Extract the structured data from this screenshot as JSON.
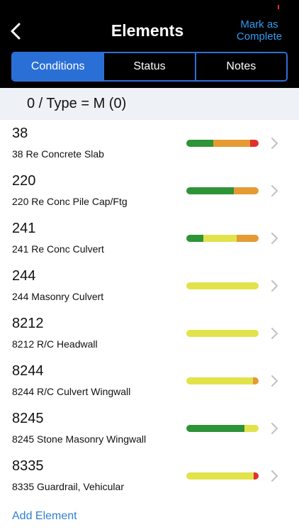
{
  "header": {
    "title": "Elements",
    "mark_complete": "Mark as Complete",
    "back_icon": "chevron-left-icon"
  },
  "tabs": [
    {
      "label": "Conditions",
      "active": true
    },
    {
      "label": "Status",
      "active": false
    },
    {
      "label": "Notes",
      "active": false
    }
  ],
  "filter": {
    "text": "0 / Type = M (0)"
  },
  "colors": {
    "green": "#2e9437",
    "yellow": "#e2e34a",
    "orange": "#e59a33",
    "red": "#e0312b",
    "accent": "#2a6fd6",
    "link": "#2f7fd1"
  },
  "elements": [
    {
      "code": "38",
      "description": "38 Re Concrete Slab",
      "condition": [
        {
          "state": "green",
          "fraction": 0.37
        },
        {
          "state": "orange",
          "fraction": 0.51
        },
        {
          "state": "red",
          "fraction": 0.12
        }
      ]
    },
    {
      "code": "220",
      "description": "220 Re Conc Pile Cap/Ftg",
      "condition": [
        {
          "state": "green",
          "fraction": 0.66
        },
        {
          "state": "orange",
          "fraction": 0.34
        }
      ]
    },
    {
      "code": "241",
      "description": "241 Re Conc Culvert",
      "condition": [
        {
          "state": "green",
          "fraction": 0.24
        },
        {
          "state": "yellow",
          "fraction": 0.46
        },
        {
          "state": "orange",
          "fraction": 0.3
        }
      ]
    },
    {
      "code": "244",
      "description": "244 Masonry Culvert",
      "condition": [
        {
          "state": "yellow",
          "fraction": 1.0
        }
      ]
    },
    {
      "code": "8212",
      "description": "8212 R/C Headwall",
      "condition": [
        {
          "state": "yellow",
          "fraction": 1.0
        }
      ]
    },
    {
      "code": "8244",
      "description": "8244 R/C Culvert Wingwall",
      "condition": [
        {
          "state": "yellow",
          "fraction": 0.92
        },
        {
          "state": "orange",
          "fraction": 0.08
        }
      ]
    },
    {
      "code": "8245",
      "description": "8245 Stone Masonry Wingwall",
      "condition": [
        {
          "state": "green",
          "fraction": 0.8
        },
        {
          "state": "yellow",
          "fraction": 0.2
        }
      ]
    },
    {
      "code": "8335",
      "description": "8335 Guardrail, Vehicular",
      "condition": [
        {
          "state": "yellow",
          "fraction": 0.93
        },
        {
          "state": "red",
          "fraction": 0.07
        }
      ]
    }
  ],
  "add_element": "Add Element"
}
